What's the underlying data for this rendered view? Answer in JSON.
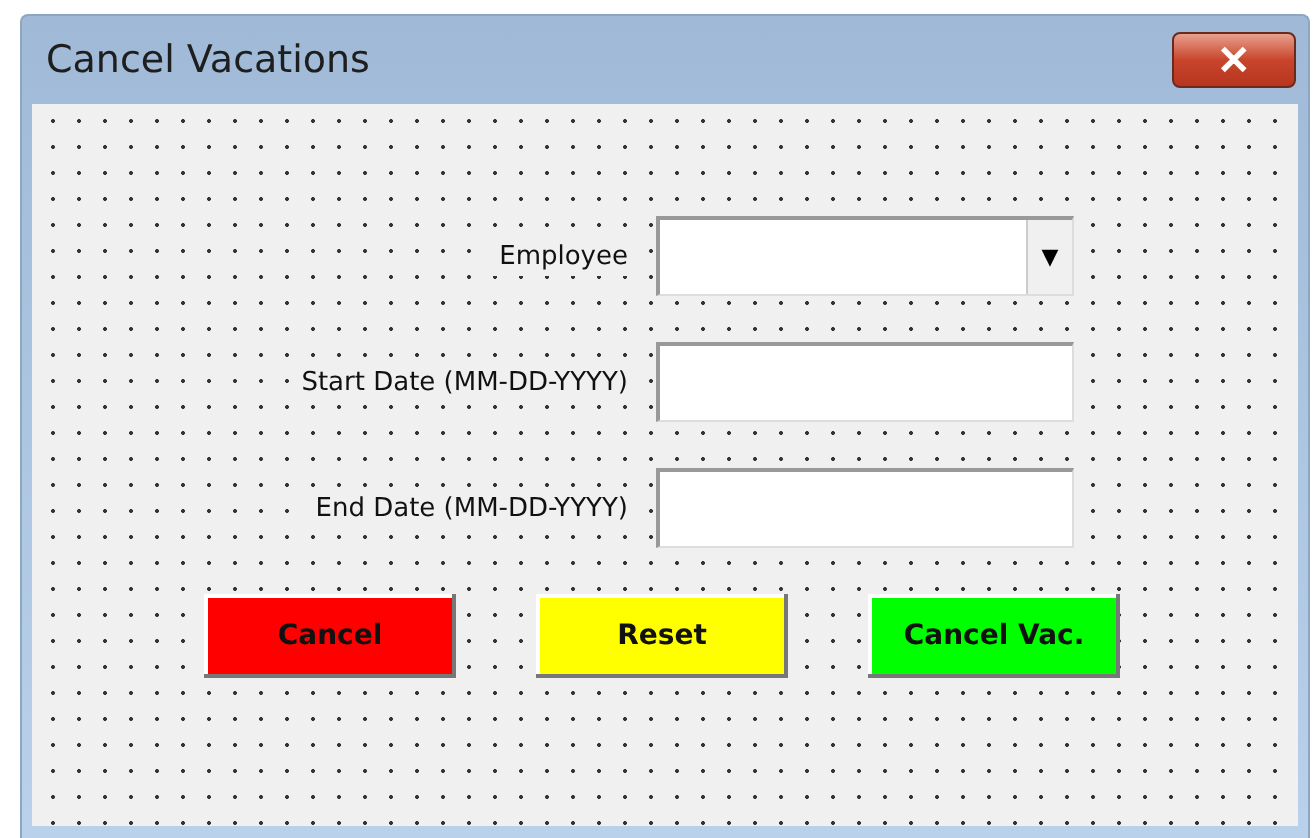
{
  "window": {
    "title": "Cancel Vacations",
    "close": "✕"
  },
  "fields": [
    {
      "label": "Employee",
      "kind": "combo",
      "arrow": "▼"
    },
    {
      "label": "Start Date (MM-DD-YYYY)",
      "kind": "text"
    },
    {
      "label": "End Date (MM-DD-YYYY)",
      "kind": "text"
    }
  ],
  "buttons": [
    {
      "label": "Cancel",
      "color": "#ff0000"
    },
    {
      "label": "Reset",
      "color": "#ffff00"
    },
    {
      "label": "Cancel Vac.",
      "color": "#00ff00"
    }
  ]
}
